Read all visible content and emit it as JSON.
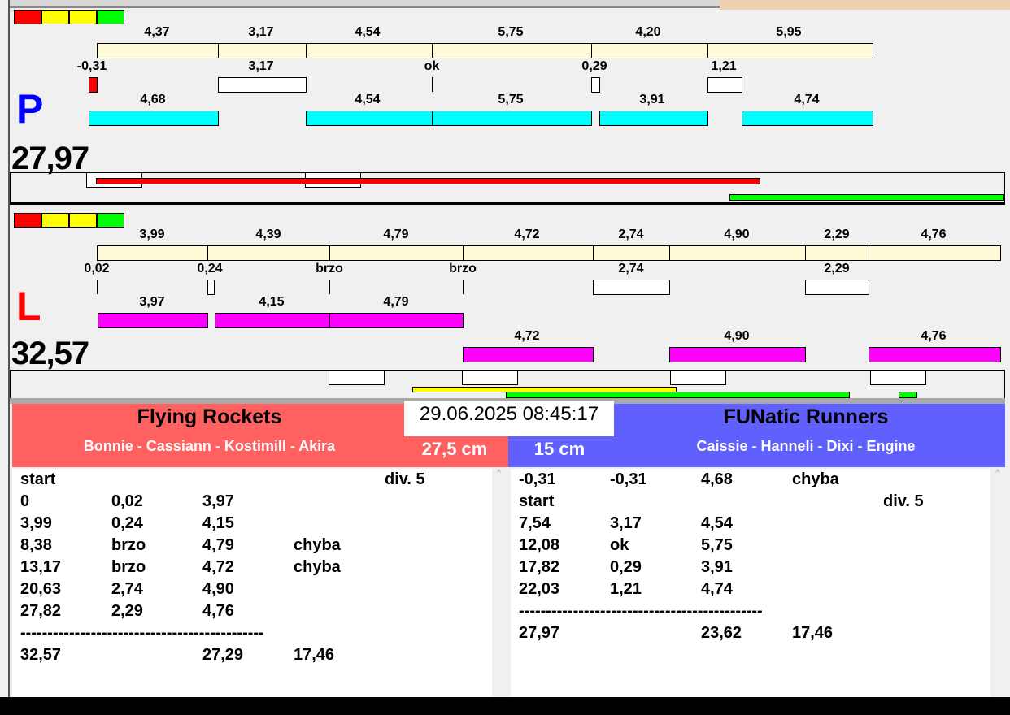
{
  "colors": {
    "red": "#ff0000",
    "yellow": "#ffff00",
    "green": "#00ff00",
    "cream": "#fffad8",
    "cyan": "#00ffff",
    "magenta": "#ff00ff",
    "team_left": "#ff6060",
    "team_right": "#6060ff"
  },
  "top": {
    "lane": "P",
    "total": "27,97",
    "row1": [
      "4,37",
      "3,17",
      "4,54",
      "5,75",
      "4,20",
      "5,95"
    ],
    "row2": [
      "-0,31",
      "3,17",
      "ok",
      "0,29",
      "1,21"
    ],
    "row3": [
      "4,68",
      "4,54",
      "5,75",
      "3,91",
      "4,74"
    ]
  },
  "bottom": {
    "lane": "L",
    "total": "32,57",
    "row1": [
      "3,99",
      "4,39",
      "4,79",
      "4,72",
      "2,74",
      "4,90",
      "2,29",
      "4,76"
    ],
    "row2": [
      "0,02",
      "0,24",
      "brzo",
      "brzo",
      "2,74",
      "2,29"
    ],
    "row3": [
      "3,97",
      "4,15",
      "4,79"
    ],
    "row4": [
      "4,72",
      "4,90",
      "4,76"
    ]
  },
  "datetime": "29.06.2025 08:45:17",
  "left_team": {
    "name": "Flying Rockets",
    "members": "Bonnie - Cassiann - Kostimill - Akira",
    "distance": "27,5 cm",
    "rows": [
      [
        "start",
        "",
        "",
        "",
        "div.  5"
      ],
      [
        "0",
        "0,02",
        "3,97",
        "",
        ""
      ],
      [
        "3,99",
        "0,24",
        "4,15",
        "",
        ""
      ],
      [
        "8,38",
        "brzo",
        "4,79",
        "chyba",
        ""
      ],
      [
        "13,17",
        "brzo",
        "4,72",
        "chyba",
        ""
      ],
      [
        "20,63",
        "2,74",
        "4,90",
        "",
        ""
      ],
      [
        "27,82",
        "2,29",
        "4,76",
        "",
        ""
      ],
      [
        "---------------------------------------------",
        "",
        "",
        "",
        ""
      ],
      [
        "32,57",
        "",
        "27,29",
        "17,46",
        ""
      ]
    ]
  },
  "right_team": {
    "name": "FUNatic Runners",
    "members": "Caissie - Hanneli - Dixi - Engine",
    "distance": "15 cm",
    "rows": [
      [
        "-0,31",
        "-0,31",
        "4,68",
        "chyba",
        ""
      ],
      [
        "start",
        "",
        "",
        "",
        "div.  5"
      ],
      [
        "7,54",
        "3,17",
        "4,54",
        "",
        ""
      ],
      [
        "12,08",
        "ok",
        "5,75",
        "",
        ""
      ],
      [
        "17,82",
        "0,29",
        "3,91",
        "",
        ""
      ],
      [
        "22,03",
        "1,21",
        "4,74",
        "",
        ""
      ],
      [
        "---------------------------------------------",
        "",
        "",
        "",
        ""
      ],
      [
        "27,97",
        "",
        "23,62",
        "17,46",
        ""
      ]
    ]
  }
}
